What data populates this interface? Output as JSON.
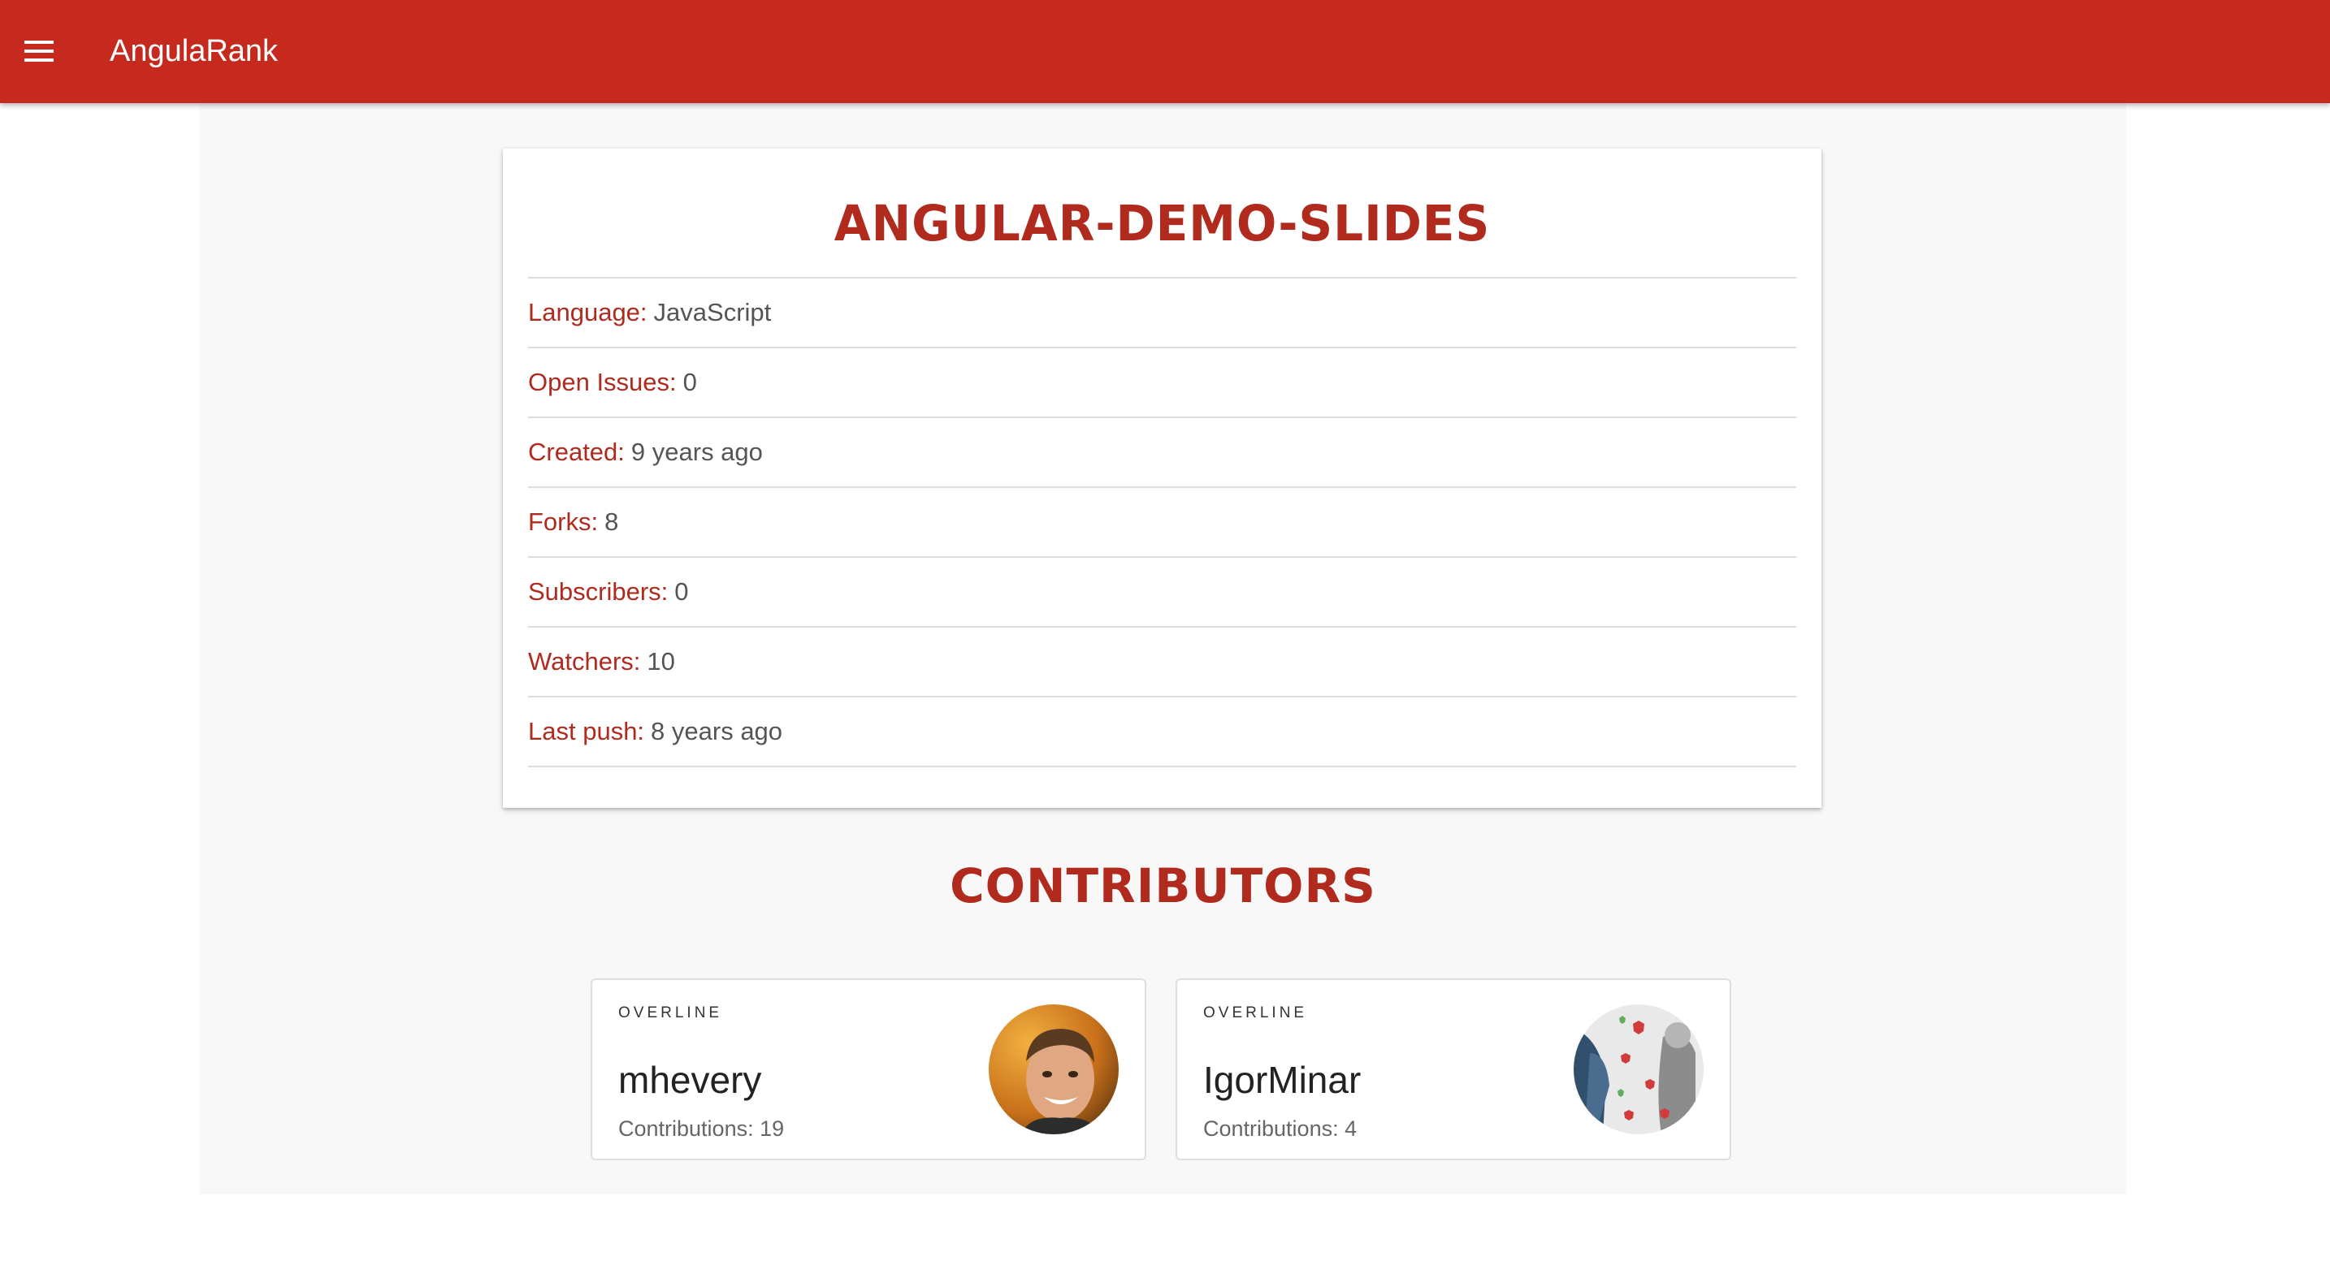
{
  "app": {
    "title": "AngulaRank",
    "menu_icon": "menu-icon",
    "accent_color": "#c62a1e",
    "heading_color": "#b02a1e"
  },
  "repo": {
    "name": "ANGULAR-DEMO-SLIDES",
    "stats": [
      {
        "label": "Language:",
        "value": "JavaScript"
      },
      {
        "label": "Open Issues:",
        "value": "0"
      },
      {
        "label": "Created:",
        "value": "9 years ago"
      },
      {
        "label": "Forks:",
        "value": "8"
      },
      {
        "label": "Subscribers:",
        "value": "0"
      },
      {
        "label": "Watchers:",
        "value": "10"
      },
      {
        "label": "Last push:",
        "value": "8 years ago"
      }
    ]
  },
  "contributors": {
    "title": "CONTRIBUTORS",
    "items": [
      {
        "overline": "OVERLINE",
        "name": "mhevery",
        "contributions": "Contributions: 19",
        "avatar_icon": "avatar-photo"
      },
      {
        "overline": "OVERLINE",
        "name": "IgorMinar",
        "contributions": "Contributions: 4",
        "avatar_icon": "avatar-photo"
      }
    ]
  }
}
